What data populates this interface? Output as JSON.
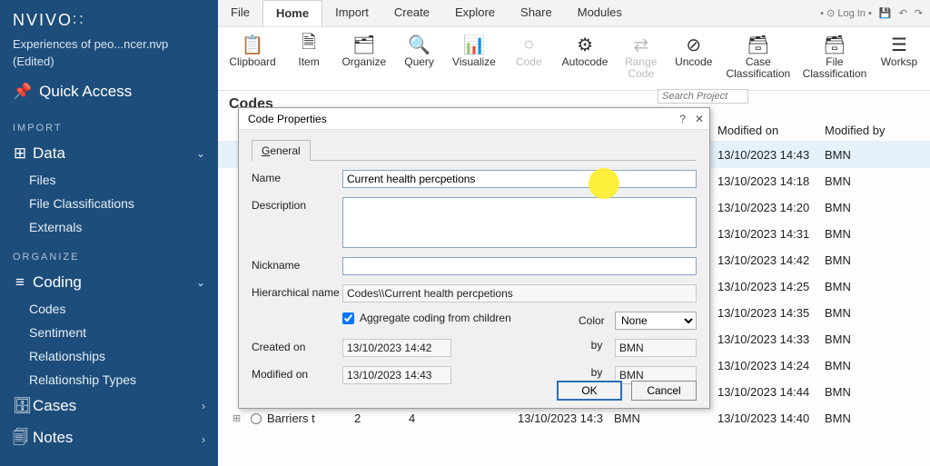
{
  "app": {
    "name": "NVIVO",
    "project": "Experiences of peo...ncer.nvp",
    "status": "(Edited)",
    "quick_access": "Quick Access"
  },
  "sections": {
    "import": "IMPORT",
    "organize": "ORGANIZE"
  },
  "nav": {
    "data": "Data",
    "data_items": [
      "Files",
      "File Classifications",
      "Externals"
    ],
    "coding": "Coding",
    "coding_items": [
      "Codes",
      "Sentiment",
      "Relationships",
      "Relationship Types"
    ],
    "cases": "Cases",
    "notes": "Notes"
  },
  "menu": {
    "tabs": [
      "File",
      "Home",
      "Import",
      "Create",
      "Explore",
      "Share",
      "Modules"
    ],
    "active": 1,
    "login": "Log In"
  },
  "ribbon": [
    {
      "label": "Clipboard",
      "icon": "📋"
    },
    {
      "label": "Item",
      "icon": "🗎"
    },
    {
      "label": "Organize",
      "icon": "🗂"
    },
    {
      "label": "Query",
      "icon": "🔍"
    },
    {
      "label": "Visualize",
      "icon": "📊"
    },
    {
      "label": "Code",
      "icon": "○",
      "disabled": true
    },
    {
      "label": "Autocode",
      "icon": "⚙"
    },
    {
      "label": "Range Code",
      "icon": "⇄",
      "disabled": true
    },
    {
      "label": "Uncode",
      "icon": "⊘"
    },
    {
      "label": "Case Classification",
      "icon": "🗃"
    },
    {
      "label": "File Classification",
      "icon": "🗃"
    },
    {
      "label": "Worksp",
      "icon": "☰"
    }
  ],
  "workarea": {
    "heading": "Codes",
    "search_placeholder": "Search Project"
  },
  "columns": {
    "modified_on": "Modified on",
    "modified_by": "Modified by"
  },
  "rows": [
    {
      "modified_on": "13/10/2023 14:43",
      "modified_by": "BMN",
      "sel": true
    },
    {
      "modified_on": "13/10/2023 14:18",
      "modified_by": "BMN"
    },
    {
      "modified_on": "13/10/2023 14:20",
      "modified_by": "BMN"
    },
    {
      "modified_on": "13/10/2023 14:31",
      "modified_by": "BMN"
    },
    {
      "modified_on": "13/10/2023 14:42",
      "modified_by": "BMN"
    },
    {
      "modified_on": "13/10/2023 14:25",
      "modified_by": "BMN"
    },
    {
      "modified_on": "13/10/2023 14:35",
      "modified_by": "BMN"
    },
    {
      "modified_on": "13/10/2023 14:33",
      "modified_by": "BMN"
    },
    {
      "modified_on": "13/10/2023 14:24",
      "modified_by": "BMN"
    },
    {
      "modified_on": "13/10/2023 14:44",
      "modified_by": "BMN"
    }
  ],
  "bottom_row": {
    "name": "Barriers t",
    "n1": "2",
    "n2": "4",
    "date": "13/10/2023 14:3",
    "by": "BMN",
    "modified_on": "13/10/2023 14:40",
    "modified_by": "BMN"
  },
  "dialog": {
    "title": "Code Properties",
    "tab": "General",
    "labels": {
      "name": "Name",
      "description": "Description",
      "nickname": "Nickname",
      "hier": "Hierarchical name",
      "agg": "Aggregate coding from children",
      "color": "Color",
      "created": "Created on",
      "modified": "Modified on",
      "by": "by"
    },
    "values": {
      "name": "Current health percpetions",
      "description": "",
      "nickname": "",
      "hier": "Codes\\\\Current health percpetions",
      "color": "None",
      "created_on": "13/10/2023 14:42",
      "created_by": "BMN",
      "modified_on": "13/10/2023 14:43",
      "modified_by": "BMN",
      "aggregate": true
    },
    "buttons": {
      "ok": "OK",
      "cancel": "Cancel"
    }
  }
}
